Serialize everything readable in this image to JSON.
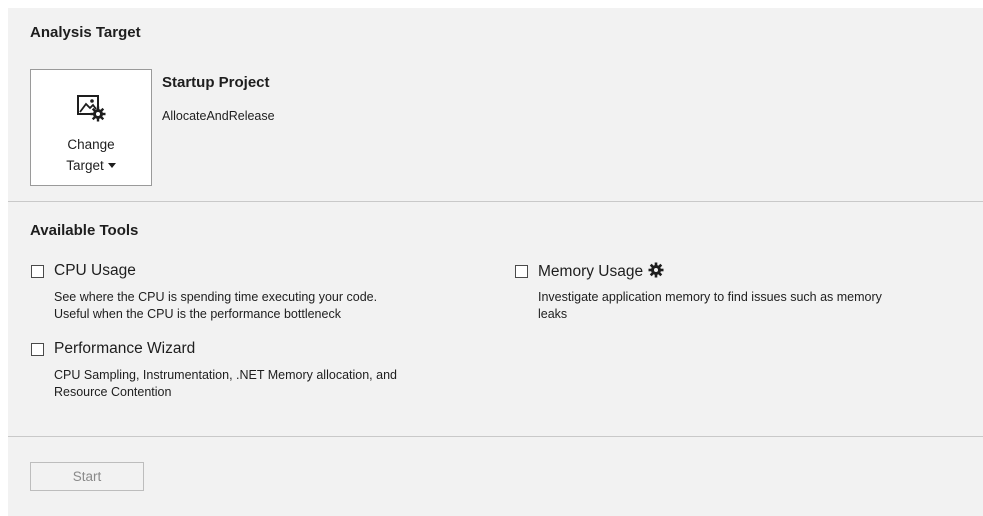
{
  "analysis_target": {
    "title": "Analysis Target",
    "change_target": {
      "label_line1": "Change",
      "label_line2": "Target",
      "icon": "change-target-icon"
    },
    "startup_project": {
      "title": "Startup Project",
      "value": "AllocateAndRelease"
    }
  },
  "available_tools": {
    "title": "Available Tools",
    "tools": [
      {
        "name": "CPU Usage",
        "checked": false,
        "description_line1": "See where the CPU is spending time executing your code.",
        "description_line2": "Useful when the CPU is the performance bottleneck"
      },
      {
        "name": "Memory Usage",
        "checked": false,
        "icon": "gear-icon",
        "description_line1": "Investigate application memory to find issues such as memory",
        "description_line2": "leaks"
      },
      {
        "name": "Performance Wizard",
        "checked": false,
        "description_line1": "CPU Sampling, Instrumentation, .NET Memory allocation, and",
        "description_line2": "Resource Contention"
      }
    ]
  },
  "footer": {
    "start_label": "Start",
    "start_enabled": false
  },
  "colors": {
    "panel_bg": "#f2f2f2",
    "text": "#1e1e1e",
    "disabled_text": "#8a8a8a",
    "divider": "#c9c9c9"
  }
}
